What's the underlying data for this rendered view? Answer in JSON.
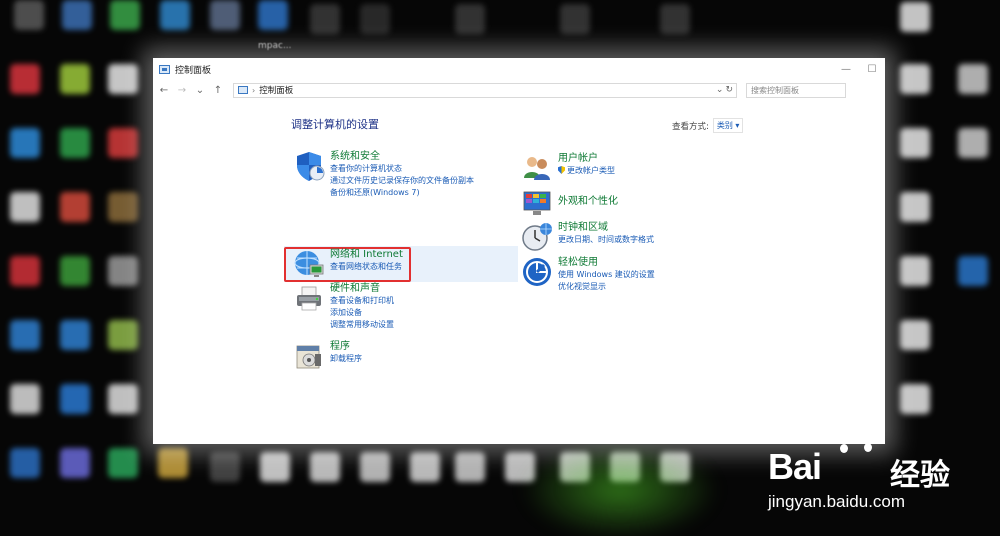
{
  "window": {
    "title": "控制面板",
    "minimize": "—",
    "maximize": "☐"
  },
  "nav": {
    "back": "←",
    "forward": "→",
    "recent": "⌄",
    "up": "↑"
  },
  "address": {
    "path": "控制面板",
    "separator": "›",
    "dropdown": "⌄",
    "refresh": "↻"
  },
  "search": {
    "placeholder": "搜索控制面板"
  },
  "desktop_caption": "mpac...",
  "main": {
    "title": "调整计算机的设置",
    "view_by_label": "查看方式:",
    "view_by_value": "类别",
    "view_by_caret": "▾"
  },
  "categories": {
    "system": {
      "title": "系统和安全",
      "links": [
        "查看你的计算机状态",
        "通过文件历史记录保存你的文件备份副本",
        "备份和还原(Windows 7)"
      ]
    },
    "network": {
      "title": "网络和 Internet",
      "links": [
        "查看网络状态和任务"
      ]
    },
    "hardware": {
      "title": "硬件和声音",
      "links": [
        "查看设备和打印机",
        "添加设备",
        "调整常用移动设置"
      ]
    },
    "programs": {
      "title": "程序",
      "links": [
        "卸载程序"
      ]
    },
    "accounts": {
      "title": "用户帐户",
      "links": [
        "更改帐户类型"
      ]
    },
    "appearance": {
      "title": "外观和个性化",
      "links": []
    },
    "clock": {
      "title": "时钟和区域",
      "links": [
        "更改日期、时间或数字格式"
      ]
    },
    "ease": {
      "title": "轻松使用",
      "links": [
        "使用 Windows 建议的设置",
        "优化视觉显示"
      ]
    }
  },
  "watermark": {
    "brand": "Bai",
    "brand_cn": "经验",
    "url": "jingyan.baidu.com"
  },
  "colors": {
    "category_title": "#0f7a35",
    "link": "#1a5bb5",
    "page_title": "#1e3287",
    "highlight_border": "#e23030",
    "highlight_bg": "#e8f1fb"
  }
}
